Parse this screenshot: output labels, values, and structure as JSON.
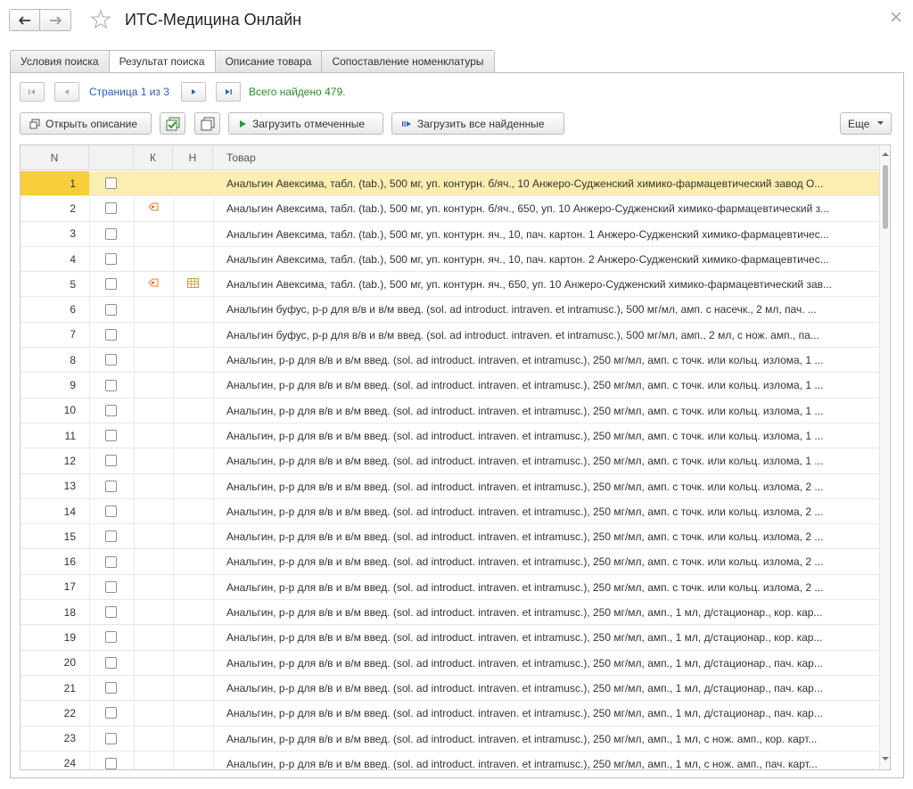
{
  "window": {
    "title": "ИТС-Медицина Онлайн"
  },
  "tabs": [
    {
      "label": "Условия поиска",
      "active": false
    },
    {
      "label": "Результат поиска",
      "active": true
    },
    {
      "label": "Описание товара",
      "active": false
    },
    {
      "label": "Сопоставление номенклатуры",
      "active": false
    }
  ],
  "pager": {
    "page_text": "Страница 1 из 3",
    "found_text": "Всего найдено 479."
  },
  "toolbar": {
    "open_description": "Открыть описание",
    "load_checked": "Загрузить отмеченные",
    "load_all": "Загрузить все найденные",
    "more": "Еще"
  },
  "grid": {
    "columns": [
      "N",
      "",
      "К",
      "Н",
      "Товар"
    ],
    "rows": [
      {
        "n": "1",
        "checked": false,
        "k_icon": "",
        "h_icon": "",
        "name": "Анальгин Авексима, табл. (tab.), 500 мг, уп. контурн. б/яч., 10 Анжеро-Судженский химико-фармацевтический завод О...",
        "selected": true
      },
      {
        "n": "2",
        "checked": false,
        "k_icon": "tag-icon",
        "h_icon": "",
        "name": "Анальгин Авексима, табл. (tab.), 500 мг, уп. контурн. б/яч., 650, уп. 10 Анжеро-Судженский химико-фармацевтический з...",
        "selected": false
      },
      {
        "n": "3",
        "checked": false,
        "k_icon": "",
        "h_icon": "",
        "name": "Анальгин Авексима, табл. (tab.), 500 мг, уп. контурн. яч., 10, пач. картон. 1 Анжеро-Судженский химико-фармацевтичес...",
        "selected": false
      },
      {
        "n": "4",
        "checked": false,
        "k_icon": "",
        "h_icon": "",
        "name": "Анальгин Авексима, табл. (tab.), 500 мг, уп. контурн. яч., 10, пач. картон. 2 Анжеро-Судженский химико-фармацевтичес...",
        "selected": false
      },
      {
        "n": "5",
        "checked": false,
        "k_icon": "tag-icon",
        "h_icon": "table-icon",
        "name": "Анальгин Авексима, табл. (tab.), 500 мг, уп. контурн. яч., 650, уп. 10 Анжеро-Судженский химико-фармацевтический зав...",
        "selected": false
      },
      {
        "n": "6",
        "checked": false,
        "k_icon": "",
        "h_icon": "",
        "name": "Анальгин буфус, р-р для в/в и в/м введ. (sol. ad introduct. intraven. et intramusc.), 500 мг/мл, амп. с насечк., 2 мл, пач. ...",
        "selected": false
      },
      {
        "n": "7",
        "checked": false,
        "k_icon": "",
        "h_icon": "",
        "name": "Анальгин буфус, р-р для в/в и в/м введ. (sol. ad introduct. intraven. et intramusc.), 500 мг/мл, амп., 2 мл, с нож. амп., па...",
        "selected": false
      },
      {
        "n": "8",
        "checked": false,
        "k_icon": "",
        "h_icon": "",
        "name": "Анальгин, р-р для в/в и в/м введ. (sol. ad introduct. intraven. et intramusc.), 250 мг/мл, амп. с точк. или кольц. излома, 1 ...",
        "selected": false
      },
      {
        "n": "9",
        "checked": false,
        "k_icon": "",
        "h_icon": "",
        "name": "Анальгин, р-р для в/в и в/м введ. (sol. ad introduct. intraven. et intramusc.), 250 мг/мл, амп. с точк. или кольц. излома, 1 ...",
        "selected": false
      },
      {
        "n": "10",
        "checked": false,
        "k_icon": "",
        "h_icon": "",
        "name": "Анальгин, р-р для в/в и в/м введ. (sol. ad introduct. intraven. et intramusc.), 250 мг/мл, амп. с точк. или кольц. излома, 1 ...",
        "selected": false
      },
      {
        "n": "11",
        "checked": false,
        "k_icon": "",
        "h_icon": "",
        "name": "Анальгин, р-р для в/в и в/м введ. (sol. ad introduct. intraven. et intramusc.), 250 мг/мл, амп. с точк. или кольц. излома, 1 ...",
        "selected": false
      },
      {
        "n": "12",
        "checked": false,
        "k_icon": "",
        "h_icon": "",
        "name": "Анальгин, р-р для в/в и в/м введ. (sol. ad introduct. intraven. et intramusc.), 250 мг/мл, амп. с точк. или кольц. излома, 1 ...",
        "selected": false
      },
      {
        "n": "13",
        "checked": false,
        "k_icon": "",
        "h_icon": "",
        "name": "Анальгин, р-р для в/в и в/м введ. (sol. ad introduct. intraven. et intramusc.), 250 мг/мл, амп. с точк. или кольц. излома, 2 ...",
        "selected": false
      },
      {
        "n": "14",
        "checked": false,
        "k_icon": "",
        "h_icon": "",
        "name": "Анальгин, р-р для в/в и в/м введ. (sol. ad introduct. intraven. et intramusc.), 250 мг/мл, амп. с точк. или кольц. излома, 2 ...",
        "selected": false
      },
      {
        "n": "15",
        "checked": false,
        "k_icon": "",
        "h_icon": "",
        "name": "Анальгин, р-р для в/в и в/м введ. (sol. ad introduct. intraven. et intramusc.), 250 мг/мл, амп. с точк. или кольц. излома, 2 ...",
        "selected": false
      },
      {
        "n": "16",
        "checked": false,
        "k_icon": "",
        "h_icon": "",
        "name": "Анальгин, р-р для в/в и в/м введ. (sol. ad introduct. intraven. et intramusc.), 250 мг/мл, амп. с точк. или кольц. излома, 2 ...",
        "selected": false
      },
      {
        "n": "17",
        "checked": false,
        "k_icon": "",
        "h_icon": "",
        "name": "Анальгин, р-р для в/в и в/м введ. (sol. ad introduct. intraven. et intramusc.), 250 мг/мл, амп. с точк. или кольц. излома, 2 ...",
        "selected": false
      },
      {
        "n": "18",
        "checked": false,
        "k_icon": "",
        "h_icon": "",
        "name": "Анальгин, р-р для в/в и в/м введ. (sol. ad introduct. intraven. et intramusc.), 250 мг/мл, амп., 1 мл, д/стационар., кор. кар...",
        "selected": false
      },
      {
        "n": "19",
        "checked": false,
        "k_icon": "",
        "h_icon": "",
        "name": "Анальгин, р-р для в/в и в/м введ. (sol. ad introduct. intraven. et intramusc.), 250 мг/мл, амп., 1 мл, д/стационар., кор. кар...",
        "selected": false
      },
      {
        "n": "20",
        "checked": false,
        "k_icon": "",
        "h_icon": "",
        "name": "Анальгин, р-р для в/в и в/м введ. (sol. ad introduct. intraven. et intramusc.), 250 мг/мл, амп., 1 мл, д/стационар., пач. кар...",
        "selected": false
      },
      {
        "n": "21",
        "checked": false,
        "k_icon": "",
        "h_icon": "",
        "name": "Анальгин, р-р для в/в и в/м введ. (sol. ad introduct. intraven. et intramusc.), 250 мг/мл, амп., 1 мл, д/стационар., пач. кар...",
        "selected": false
      },
      {
        "n": "22",
        "checked": false,
        "k_icon": "",
        "h_icon": "",
        "name": "Анальгин, р-р для в/в и в/м введ. (sol. ad introduct. intraven. et intramusc.), 250 мг/мл, амп., 1 мл, д/стационар., пач. кар...",
        "selected": false
      },
      {
        "n": "23",
        "checked": false,
        "k_icon": "",
        "h_icon": "",
        "name": "Анальгин, р-р для в/в и в/м введ. (sol. ad introduct. intraven. et intramusc.), 250 мг/мл, амп., 1 мл, с нож. амп., кор. карт...",
        "selected": false
      },
      {
        "n": "24",
        "checked": false,
        "k_icon": "",
        "h_icon": "",
        "name": "Анальгин, р-р для в/в и в/м введ. (sol. ad introduct. intraven. et intramusc.), 250 мг/мл, амп., 1 мл, с нож. амп., пач. карт...",
        "selected": false
      }
    ]
  },
  "colors": {
    "selected_row": "#fbeeb0",
    "selected_cell": "#f7cd3b",
    "link_blue": "#2d5fa7",
    "found_green": "#2b8a2b"
  }
}
